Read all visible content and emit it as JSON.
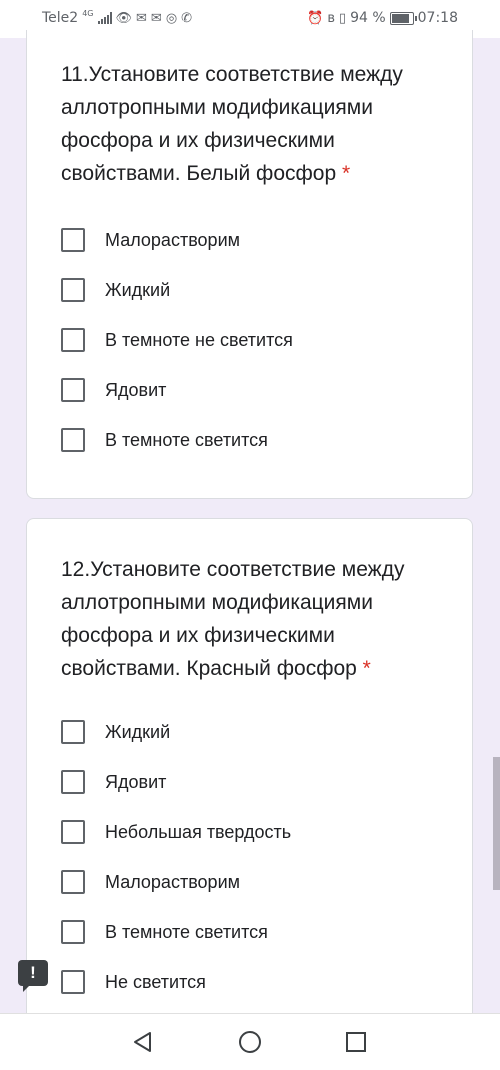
{
  "status_bar": {
    "carrier": "Tele2",
    "network": "4G",
    "battery": "94 %",
    "time": "07:18"
  },
  "questions": [
    {
      "title": "11.Установите соответствие между аллотропными модификациями фосфора и их физическими свойствами. Белый фосфор",
      "required_mark": "*",
      "options": [
        {
          "label": "Малорастворим",
          "checked": false
        },
        {
          "label": "Жидкий",
          "checked": false
        },
        {
          "label": "В темноте не светится",
          "checked": false
        },
        {
          "label": "Ядовит",
          "checked": false
        },
        {
          "label": "В темноте светится",
          "checked": false
        }
      ]
    },
    {
      "title": "12.Установите соответствие между аллотропными модификациями фосфора и их физическими свойствами. Красный фосфор",
      "required_mark": "*",
      "options": [
        {
          "label": "Жидкий",
          "checked": false
        },
        {
          "label": "Ядовит",
          "checked": false
        },
        {
          "label": "Небольшая твердость",
          "checked": false
        },
        {
          "label": "Малорастворим",
          "checked": false
        },
        {
          "label": "В темноте светится",
          "checked": false
        },
        {
          "label": "Не светится",
          "checked": false
        }
      ]
    }
  ],
  "report_button": {
    "symbol": "!"
  },
  "colors": {
    "background": "#f0ebf8",
    "required": "#d93025",
    "text": "#202124"
  }
}
